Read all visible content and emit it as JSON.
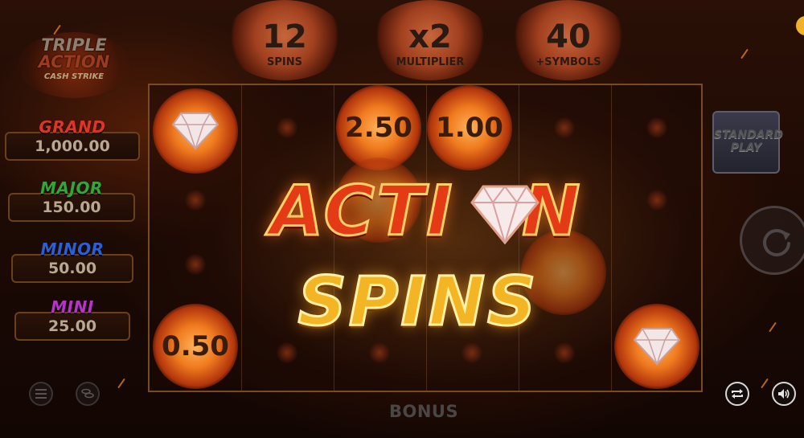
{
  "logo": {
    "line1": "TRIPLE",
    "line2": "ACTION",
    "line3": "CASH STRIKE"
  },
  "jackpots": [
    {
      "name": "GRAND",
      "value": "1,000.00",
      "color": "#e0332a"
    },
    {
      "name": "MAJOR",
      "value": "150.00",
      "color": "#2fa73a"
    },
    {
      "name": "MINOR",
      "value": "50.00",
      "color": "#2b5fd6"
    },
    {
      "name": "MINI",
      "value": "25.00",
      "color": "#b533c9"
    }
  ],
  "counters": [
    {
      "value": "12",
      "label": "SPINS"
    },
    {
      "value": "x2",
      "label": "MULTIPLIER"
    },
    {
      "value": "40",
      "label": "+SYMBOLS"
    }
  ],
  "reels": {
    "values": [
      "2.50",
      "1.00",
      "0.50"
    ]
  },
  "overlay": {
    "line1": "ACTI",
    "line1b": "N",
    "line2": "SPINS"
  },
  "buttons": {
    "standard_play": "STANDARD PLAY"
  },
  "footer": {
    "bonus_label": "BONUS"
  },
  "icons": [
    "menu-icon",
    "coins-icon",
    "autoplay-icon",
    "sound-icon",
    "spin-icon",
    "diamond-icon"
  ],
  "colors": {
    "accent_red": "#e53a16",
    "accent_gold": "#f3b524",
    "frame": "#7a4a20"
  }
}
